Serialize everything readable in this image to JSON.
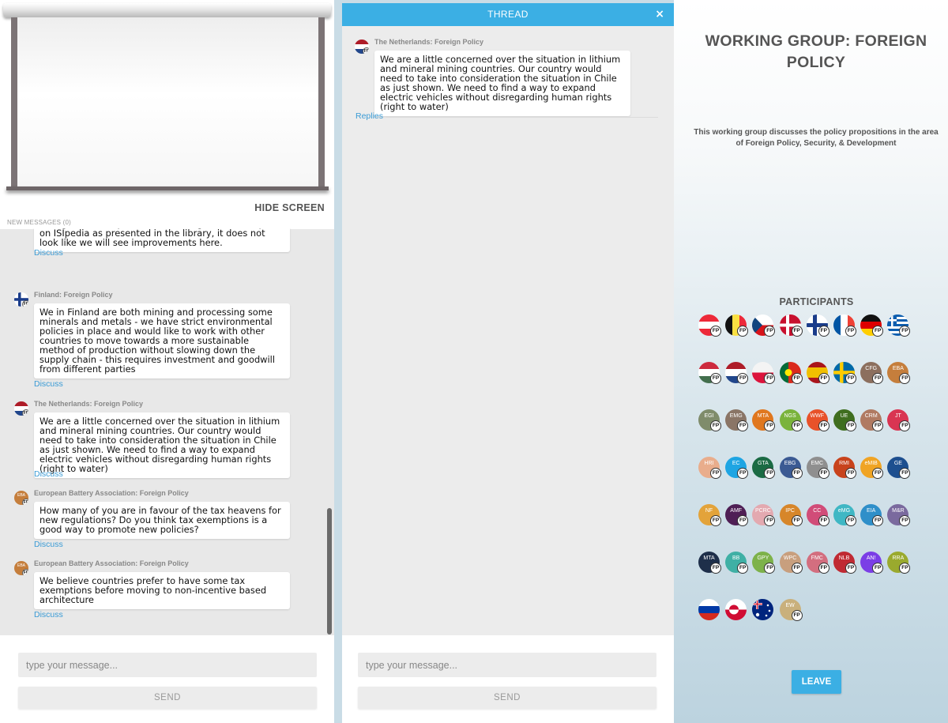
{
  "screen": {
    "hide_label": "HIDE SCREEN"
  },
  "feed": {
    "new_messages_label": "NEW MESSAGES (0)",
    "discuss_label": "Discuss",
    "messages": [
      {
        "sender": "",
        "flag": "none",
        "text": "climate impacts outside of Europe. We are already facing climate impacts , and looking at future impacts on ISIpedia as presented in the library, it does not look like we will see improvements here."
      },
      {
        "sender": "Finland: Foreign Policy",
        "flag": "finland",
        "text": "We in Finland are both mining and processing some minerals and metals - we have strict environmental policies in place and would like to work with other countries to move towards a more sustainable method of production without slowing down the supply chain - this requires investment and goodwill from different parties"
      },
      {
        "sender": "The Netherlands: Foreign Policy",
        "flag": "netherlands",
        "text": "We are a little concerned over the situation in lithium and mineral mining countries. Our country would need to take into consideration the situation in Chile as just shown. We need to find a way to expand electric vehicles without disregarding human rights (right to water)"
      },
      {
        "sender": "European Battery Association: Foreign Policy",
        "flag": "EBA",
        "text": "How many of you are in favour of the tax heavens for new regulations? Do you think tax exemptions is a good way to promote new policies?"
      },
      {
        "sender": "European Battery Association: Foreign Policy",
        "flag": "EBA",
        "text": "We believe countries prefer to have some tax exemptions before moving to non-incentive based architecture"
      }
    ]
  },
  "compose": {
    "placeholder": "type your message...",
    "send_label": "SEND"
  },
  "thread": {
    "title": "THREAD",
    "close_label": "×",
    "message": {
      "sender": "The Netherlands: Foreign Policy",
      "flag": "netherlands",
      "text": "We are a little concerned over the situation in lithium and mineral mining countries. Our country would need to take into consideration the situation in Chile as just shown. We need to find a way to expand electric vehicles without disregarding human rights (right to water)"
    },
    "replies_label": "Replies"
  },
  "group": {
    "title": "WORKING GROUP: FOREIGN POLICY",
    "description": "This working group discusses the policy propositions in the area of Foreign Policy, Security, & Development",
    "participants_label": "PARTICIPANTS",
    "fp_badge": "FP",
    "participants": [
      {
        "label": "",
        "kind": "austria"
      },
      {
        "label": "",
        "kind": "belgium"
      },
      {
        "label": "",
        "kind": "czech"
      },
      {
        "label": "",
        "kind": "denmark"
      },
      {
        "label": "",
        "kind": "finland"
      },
      {
        "label": "",
        "kind": "france"
      },
      {
        "label": "",
        "kind": "germany"
      },
      {
        "label": "",
        "kind": "greece"
      },
      {
        "label": "",
        "kind": "hungary"
      },
      {
        "label": "",
        "kind": "netherlands"
      },
      {
        "label": "",
        "kind": "poland"
      },
      {
        "label": "",
        "kind": "portugal"
      },
      {
        "label": "",
        "kind": "spain"
      },
      {
        "label": "",
        "kind": "sweden"
      },
      {
        "label": "CFG",
        "kind": "org",
        "color": "#8c6f5e"
      },
      {
        "label": "EBA",
        "kind": "org",
        "color": "#c57e3c"
      },
      {
        "label": "EGI",
        "kind": "org",
        "color": "#7f8c6b"
      },
      {
        "label": "EMG",
        "kind": "org",
        "color": "#8a7566"
      },
      {
        "label": "MTA",
        "kind": "org",
        "color": "#e0771e"
      },
      {
        "label": "NGS",
        "kind": "org",
        "color": "#7ab33b"
      },
      {
        "label": "WWF",
        "kind": "org",
        "color": "#e8522a"
      },
      {
        "label": "UE",
        "kind": "org",
        "color": "#3f6e1f"
      },
      {
        "label": "CRM",
        "kind": "org",
        "color": "#b07a62"
      },
      {
        "label": "JT",
        "kind": "org",
        "color": "#d93552"
      },
      {
        "label": "HRI",
        "kind": "org",
        "color": "#e9ad8c"
      },
      {
        "label": "EC",
        "kind": "org",
        "color": "#1ea5e3"
      },
      {
        "label": "GTA",
        "kind": "org",
        "color": "#1b6b44"
      },
      {
        "label": "EBG",
        "kind": "org",
        "color": "#3b5a93"
      },
      {
        "label": "EMC",
        "kind": "org",
        "color": "#8f8f8f"
      },
      {
        "label": "RMI",
        "kind": "org",
        "color": "#c8431c"
      },
      {
        "label": "eMIB",
        "kind": "org",
        "color": "#f0a424"
      },
      {
        "label": "GE",
        "kind": "org",
        "color": "#1d4f8f"
      },
      {
        "label": "NF",
        "kind": "org",
        "color": "#e3a33a"
      },
      {
        "label": "AMF",
        "kind": "org",
        "color": "#4f1f55"
      },
      {
        "label": "PCRC",
        "kind": "org",
        "color": "#e3a9b0"
      },
      {
        "label": "IPC",
        "kind": "org",
        "color": "#d7862a"
      },
      {
        "label": "CC",
        "kind": "org",
        "color": "#d14c78"
      },
      {
        "label": "eMG",
        "kind": "org",
        "color": "#3fb7c4"
      },
      {
        "label": "EIA",
        "kind": "org",
        "color": "#2f8fc9"
      },
      {
        "label": "M&R",
        "kind": "org",
        "color": "#7a6a9e"
      },
      {
        "label": "MTA",
        "kind": "org",
        "color": "#1e2f4a"
      },
      {
        "label": "BB",
        "kind": "org",
        "color": "#3fb0a5"
      },
      {
        "label": "GPY",
        "kind": "org",
        "color": "#7db24a"
      },
      {
        "label": "WPC",
        "kind": "org",
        "color": "#c89f7e"
      },
      {
        "label": "FMC",
        "kind": "org",
        "color": "#d36e7f"
      },
      {
        "label": "NLB",
        "kind": "org",
        "color": "#c02a33"
      },
      {
        "label": "AN!",
        "kind": "org",
        "color": "#7b3ee6"
      },
      {
        "label": "RRA",
        "kind": "org",
        "color": "#9aaa2e"
      },
      {
        "label": "",
        "kind": "russia"
      },
      {
        "label": "",
        "kind": "greenland"
      },
      {
        "label": "",
        "kind": "australia"
      },
      {
        "label": "EW",
        "kind": "org",
        "color": "#c9b07c"
      }
    ],
    "leave_label": "LEAVE"
  }
}
